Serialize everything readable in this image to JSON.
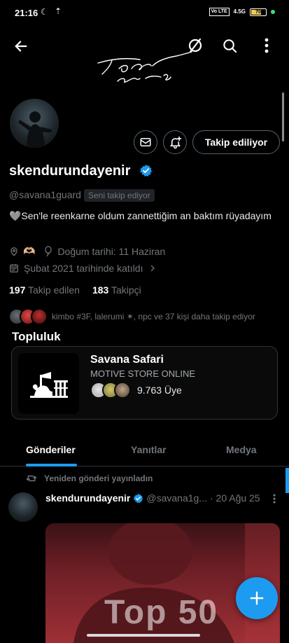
{
  "status_bar": {
    "time": "21:16",
    "network_chip": "Vo LTE",
    "signal": "4.5G",
    "battery": "70",
    "dot_color": "#3ddc84"
  },
  "header": {
    "back_icon": "arrow-left-icon",
    "icons": [
      "slash-circle-icon",
      "search-icon",
      "more-vertical-icon"
    ]
  },
  "profile": {
    "display_name": "skendurundayenir",
    "handle": "@savana1guard",
    "follows_you": "Seni takip ediyor",
    "follow_button": "Takip ediliyor",
    "bio": "🩶Sen'le reenkarne oldum zannettiğim an baktım rüyadayım",
    "location_emoji": "🫶🏼",
    "birthday": "Doğum tarihi: 11 Haziran",
    "joined": "Şubat 2021 tarihinde katıldı",
    "following_count": "197",
    "following_label": "Takip edilen",
    "followers_count": "183",
    "followers_label": "Takipçi",
    "followed_by": "kimbo #3F, lalerumi ✶, npc ve 37 kişi daha takip ediyor"
  },
  "community": {
    "section_title": "Topluluk",
    "name": "Savana Safari",
    "subtitle": "MOTIVE STORE ONLINE",
    "members": "9.763 Üye"
  },
  "tabs": [
    {
      "label": "Gönderiler",
      "active": true
    },
    {
      "label": "Yanıtlar",
      "active": false
    },
    {
      "label": "Medya",
      "active": false
    }
  ],
  "post": {
    "repost_label": "Yeniden gönderi yayınladın",
    "author_name": "skendurundayenir",
    "author_handle": "@savana1g...",
    "date": "· 20 Ağu 25",
    "media_text": "Top 50"
  },
  "colors": {
    "accent": "#1d9bf0",
    "secondary_text": "#71767b",
    "background": "#000000"
  }
}
